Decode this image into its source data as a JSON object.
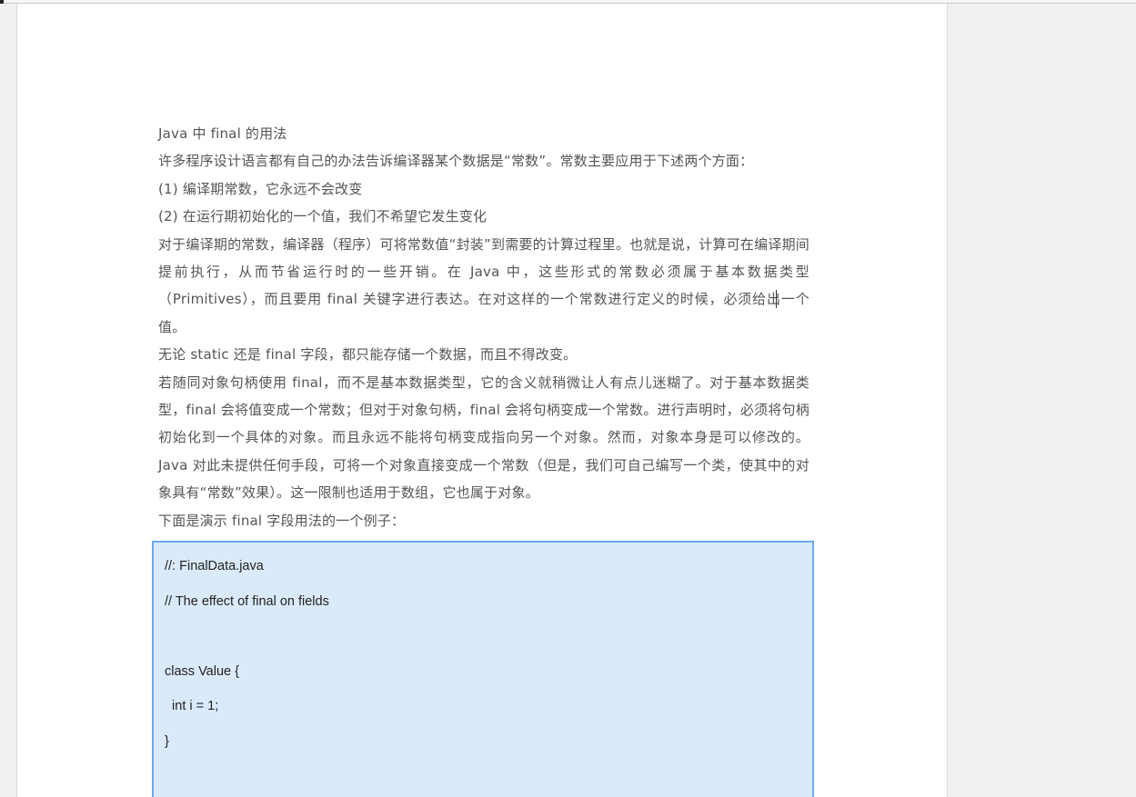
{
  "document": {
    "title": "Java 中 final 的用法",
    "paragraphs": [
      "许多程序设计语言都有自己的办法告诉编译器某个数据是“常数”。常数主要应用于下述两个方面：",
      "(1) 编译期常数，它永远不会改变",
      "(2) 在运行期初始化的一个值，我们不希望它发生变化",
      "对于编译期的常数，编译器（程序）可将常数值“封装”到需要的计算过程里。也就是说，计算可在编译期间提前执行，从而节省运行时的一些开销。在 Java 中，这些形式的常数必须属于基本数据类型（Primitives），而且要用 final 关键字进行表达。在对这样的一个常数进行定义的时候，必须给出一个值。",
      "无论 static 还是 final 字段，都只能存储一个数据，而且不得改变。",
      "若随同对象句柄使用 final，而不是基本数据类型，它的含义就稍微让人有点儿迷糊了。对于基本数据类型，final 会将值变成一个常数；但对于对象句柄，final 会将句柄变成一个常数。进行声明时，必须将句柄初始化到一个具体的对象。而且永远不能将句柄变成指向另一个对象。然而，对象本身是可以修改的。Java 对此未提供任何手段，可将一个对象直接变成一个常数（但是，我们可自己编写一个类，使其中的对象具有“常数”效果）。这一限制也适用于数组，它也属于对象。",
      "下面是演示 final 字段用法的一个例子："
    ],
    "code_lines": [
      "//: FinalData.java",
      "// The effect of final on fields",
      "",
      "class Value {",
      "  int i = 1;",
      "}",
      ""
    ]
  },
  "colors": {
    "text": "#555555",
    "code_background": "#dbeafa",
    "code_border": "#6aaaf0",
    "workspace": "#f0f0f0",
    "page": "#ffffff"
  }
}
